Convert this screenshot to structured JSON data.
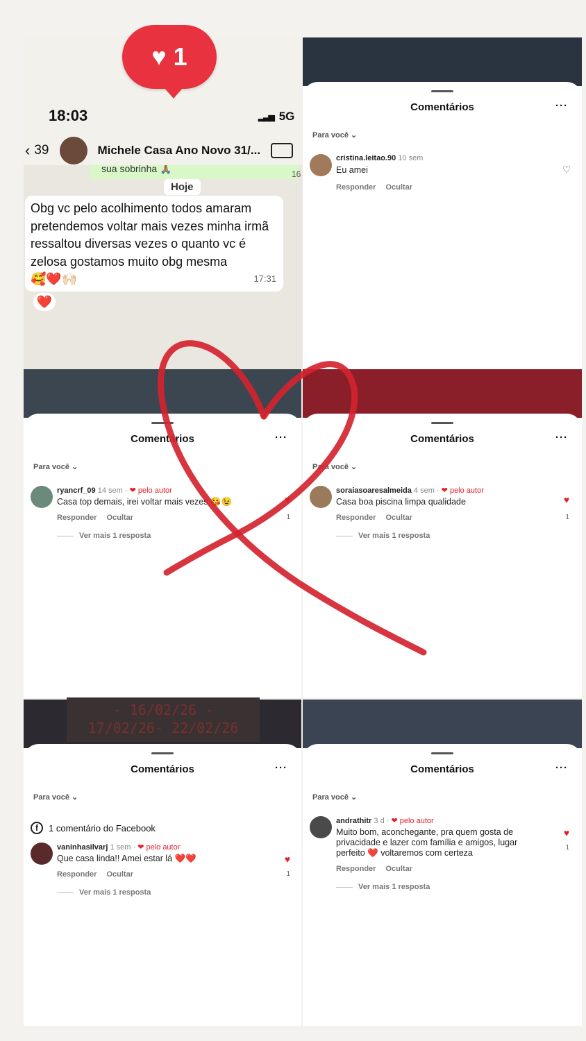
{
  "badge": {
    "icon": "heart-icon",
    "count": "1"
  },
  "whatsapp": {
    "time": "18:03",
    "network": "5G",
    "back_count": "39",
    "contact": "Michele Casa Ano Novo 31/...",
    "prev_message": "sua sobrinha 🙏🏽",
    "prev_time": "16",
    "date_label": "Hoje",
    "message": "Obg vc pelo acolhimento todos amaram pretendemos voltar mais vezes minha irmã ressaltou diversas vezes o quanto vc é zelosa gostamos muito obg mesma",
    "message_emojis": "🥰❤️🙌🏻",
    "message_time": "17:31",
    "reaction": "❤️"
  },
  "dates_text": [
    "- 16/02/26 -",
    "17/02/26- 22/02/26"
  ],
  "panels": [
    {
      "title": "Comentários",
      "more": "···",
      "filter": "Para você ⌄",
      "comments": [
        {
          "user": "cristina.leitao.90",
          "meta": "10 sem",
          "author_like": "",
          "text": "Eu amei",
          "reply": "Responder",
          "hide": "Ocultar",
          "likes": "",
          "more": ""
        }
      ]
    },
    {
      "title": "Comentários",
      "more": "···",
      "filter": "Para você ⌄",
      "comments": [
        {
          "user": "ryancrf_09",
          "meta": "14 sem ·",
          "author_like": "❤ pelo autor",
          "text": "Casa top demais, irei voltar mais vezes 😘😉",
          "reply": "Responder",
          "hide": "Ocultar",
          "likes": "1",
          "more": "Ver mais 1 resposta"
        }
      ]
    },
    {
      "title": "Comentários",
      "more": "···",
      "filter": "Para você ⌄",
      "comments": [
        {
          "user": "soraiasoaresalmeida",
          "meta": "4 sem ·",
          "author_like": "❤ pelo autor",
          "text": "Casa boa piscina  limpa qualidade",
          "reply": "Responder",
          "hide": "Ocultar",
          "likes": "1",
          "more": "Ver mais 1 resposta"
        }
      ]
    },
    {
      "title": "Comentários",
      "more": "···",
      "filter": "Para você ⌄",
      "facebook": "1 comentário do Facebook",
      "comments": [
        {
          "user": "vaninhasilvarj",
          "meta": "1 sem ·",
          "author_like": "❤ pelo autor",
          "text": "Que casa linda!! Amei estar lá ❤️❤️",
          "reply": "Responder",
          "hide": "Ocultar",
          "likes": "1",
          "more": "Ver mais 1 resposta"
        }
      ]
    },
    {
      "title": "Comentários",
      "more": "···",
      "filter": "Para você ⌄",
      "comments": [
        {
          "user": "andrathitr",
          "meta": "3 d ·",
          "author_like": "❤ pelo autor",
          "text": "Muito bom, aconchegante, pra quem gosta de privacidade e lazer com família e amigos, lugar perfeito ❤️ voltaremos com certeza",
          "reply": "Responder",
          "hide": "Ocultar",
          "likes": "1",
          "more": "Ver mais 1 resposta"
        }
      ]
    }
  ],
  "colors": {
    "accent_red": "#e8323f",
    "whatsapp_green": "#d8f8c8"
  }
}
